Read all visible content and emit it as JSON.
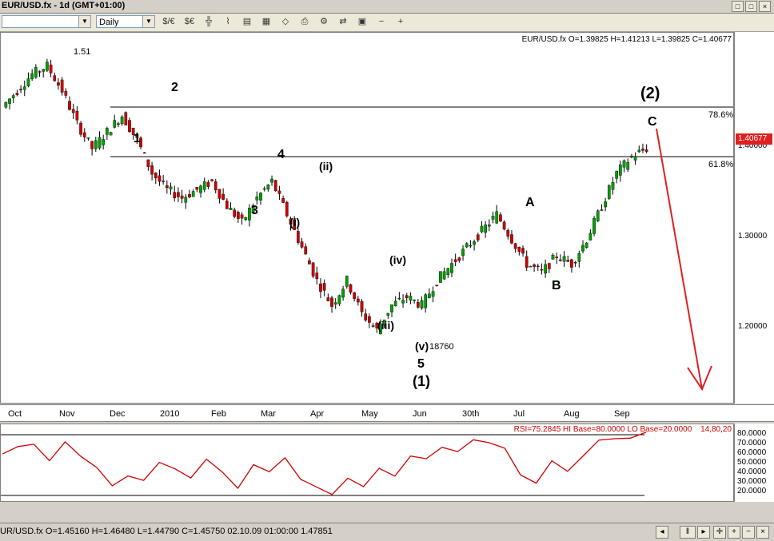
{
  "window": {
    "title": "EUR/USD.fx - 1d (GMT+01:00)",
    "buttons": [
      "□",
      "□",
      "×"
    ]
  },
  "toolbar": {
    "symbol_value": "",
    "timeframe_value": "Daily",
    "buttons": [
      {
        "name": "currency-dollar-euro-icon",
        "glyph": "$/€"
      },
      {
        "name": "currency-euro-dollar-icon",
        "glyph": "$€"
      },
      {
        "name": "crosshair-icon",
        "glyph": "╬"
      },
      {
        "name": "line-chart-icon",
        "glyph": "⌇"
      },
      {
        "name": "candlestick-icon",
        "glyph": "▤"
      },
      {
        "name": "indicator-icon",
        "glyph": "▦"
      },
      {
        "name": "drawing-icon",
        "glyph": "◇"
      },
      {
        "name": "print-icon",
        "glyph": "⎙"
      },
      {
        "name": "settings-icon",
        "glyph": "⚙"
      },
      {
        "name": "trade-icon",
        "glyph": "⇄"
      },
      {
        "name": "template-icon",
        "glyph": "▣"
      },
      {
        "name": "zoom-out-icon",
        "glyph": "−"
      },
      {
        "name": "zoom-in-icon",
        "glyph": "+"
      }
    ]
  },
  "chart": {
    "info_line": "EUR/USD.fx O=1.39825 H=1.41213 L=1.39825 C=1.40677",
    "current_price": "1.40677",
    "price_ticks": [
      "1.40000",
      "1.30000",
      "1.20000"
    ],
    "high_label": "1.51",
    "low_label": "18760",
    "fib_786": "78.6%",
    "fib_618": "61.8%",
    "wave_labels": [
      "2",
      "1",
      "4",
      "3",
      "(ii)",
      "(i)",
      "(iv)",
      "(iii)",
      "(v)",
      "5",
      "(1)",
      "A",
      "B",
      "C",
      "(2)"
    ],
    "time_labels": [
      "Oct",
      "Nov",
      "Dec",
      "2010",
      "Feb",
      "Mar",
      "Apr",
      "May",
      "Jun",
      "30th",
      "Jul",
      "Aug",
      "Sep"
    ],
    "colors": {
      "up": "#00a000",
      "down": "#d00000",
      "arrow": "#e02020",
      "rsi": "#d00000"
    }
  },
  "rsi": {
    "info": "RSI=75.2845  HI Base=80.0000  LO Base=20.0000",
    "info_right": "14,80,20",
    "ticks": [
      "80.0000",
      "70.0000",
      "60.0000",
      "50.0000",
      "40.0000",
      "30.0000",
      "20.0000"
    ]
  },
  "status": {
    "text": "UR/USD.fx O=1.45160 H=1.46480 L=1.44790 C=1.45750    02.10.09 01:00:00 1.47851",
    "buttons": [
      "◂",
      "‖",
      "▸",
      "✛",
      "+",
      "−",
      "×"
    ]
  },
  "chart_data": {
    "type": "line",
    "series": [
      {
        "values": [
          1.46,
          1.48,
          1.5,
          1.51,
          1.48,
          1.44,
          1.41,
          1.43,
          1.45,
          1.42,
          1.38,
          1.36,
          1.35,
          1.36,
          1.37,
          1.34,
          1.32,
          1.35,
          1.37,
          1.33,
          1.29,
          1.25,
          1.22,
          1.25,
          1.21,
          1.19,
          1.22,
          1.23,
          1.22,
          1.25,
          1.27,
          1.29,
          1.31,
          1.33,
          1.3,
          1.27,
          1.26,
          1.28,
          1.27,
          1.3,
          1.34,
          1.38,
          1.4,
          1.41
        ]
      }
    ],
    "x": [
      "Oct",
      "Nov",
      "Dec",
      "2010",
      "Feb",
      "Mar",
      "Apr",
      "May",
      "Jun",
      "30th",
      "Jul",
      "Aug",
      "Sep"
    ],
    "ylim": [
      1.1,
      1.55
    ]
  }
}
